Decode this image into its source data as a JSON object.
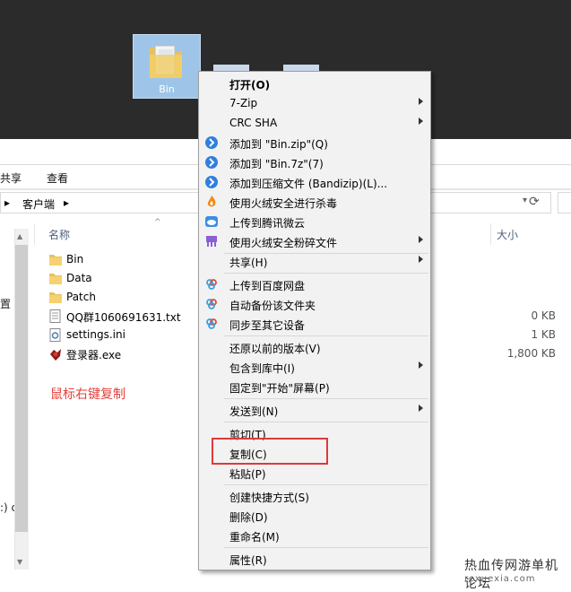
{
  "desktop": {
    "icon_label": "Bin"
  },
  "ribbon": {
    "tabs": [
      "共享",
      "查看"
    ]
  },
  "address": {
    "sep1": "▸",
    "crumb": "客户端",
    "sep2": "▸"
  },
  "columns": {
    "name": "名称",
    "size": "大小"
  },
  "nav": {
    "partial_1": "置",
    "partial_2": ":) c"
  },
  "files": [
    {
      "name": "Bin",
      "icon": "folder-icon",
      "size": ""
    },
    {
      "name": "Data",
      "icon": "folder-icon",
      "size": ""
    },
    {
      "name": "Patch",
      "icon": "folder-icon",
      "size": ""
    },
    {
      "name": "QQ群1060691631.txt",
      "icon": "text-file-icon",
      "size": "0 KB"
    },
    {
      "name": "settings.ini",
      "icon": "settings-file-icon",
      "size": "1 KB"
    },
    {
      "name": "登录器.exe",
      "icon": "exe-icon",
      "size": "1,800 KB"
    }
  ],
  "annotation": "鼠标右键复制",
  "context_menu": [
    {
      "label": "打开(O)",
      "bold": true
    },
    {
      "label": "7-Zip",
      "submenu": true
    },
    {
      "label": "CRC SHA",
      "submenu": true
    },
    {
      "label": "添加到 \"Bin.zip\"(Q)",
      "icon": "bandizip-icon"
    },
    {
      "label": "添加到 \"Bin.7z\"(7)",
      "icon": "bandizip-icon"
    },
    {
      "label": "添加到压缩文件 (Bandizip)(L)...",
      "icon": "bandizip-icon"
    },
    {
      "label": "使用火绒安全进行杀毒",
      "icon": "huorong-icon"
    },
    {
      "label": "上传到腾讯微云",
      "icon": "weiyun-icon"
    },
    {
      "label": "使用火绒安全粉碎文件",
      "icon": "shredder-icon",
      "submenu": true
    },
    {
      "label": "共享(H)",
      "submenu": true
    },
    {
      "label": "上传到百度网盘",
      "icon": "baidu-cloud-icon"
    },
    {
      "label": "自动备份该文件夹",
      "icon": "baidu-cloud-icon"
    },
    {
      "label": "同步至其它设备",
      "icon": "baidu-cloud-icon"
    },
    {
      "label": "还原以前的版本(V)"
    },
    {
      "label": "包含到库中(I)",
      "submenu": true
    },
    {
      "label": "固定到\"开始\"屏幕(P)"
    },
    {
      "label": "发送到(N)",
      "submenu": true
    },
    {
      "label": "剪切(T)"
    },
    {
      "label": "复制(C)"
    },
    {
      "label": "粘贴(P)"
    },
    {
      "label": "创建快捷方式(S)"
    },
    {
      "label": "删除(D)"
    },
    {
      "label": "重命名(M)"
    },
    {
      "label": "属性(R)"
    }
  ],
  "watermark": {
    "text": "热血传网游单机论坛",
    "url": "rexuexia.com"
  },
  "colors": {
    "highlight": "#e0393a",
    "annotation": "#e53f3a",
    "selection": "#9ec5e8"
  }
}
